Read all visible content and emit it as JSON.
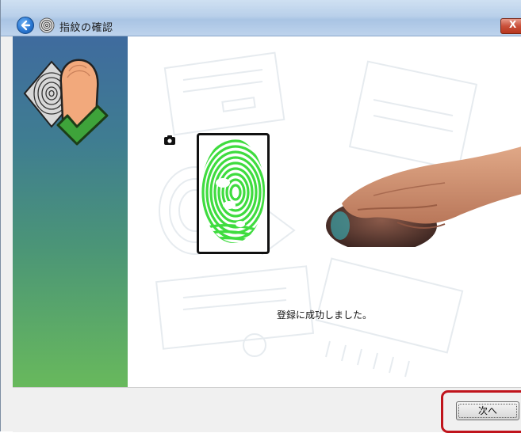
{
  "window": {
    "title": "指紋の確認",
    "close_label": "X"
  },
  "content": {
    "status_message": "登録に成功しました。"
  },
  "footer": {
    "next_label": "次へ"
  },
  "colors": {
    "highlight": "#c0141c",
    "fingerprint_green": "#3fdc3f",
    "panel_top": "#3f6b9e",
    "panel_bottom": "#68b95c"
  },
  "icons": {
    "back": "back-arrow-icon",
    "title": "fingerprint-icon",
    "side": "fingerprint-check-icon",
    "camera": "camera-icon"
  }
}
